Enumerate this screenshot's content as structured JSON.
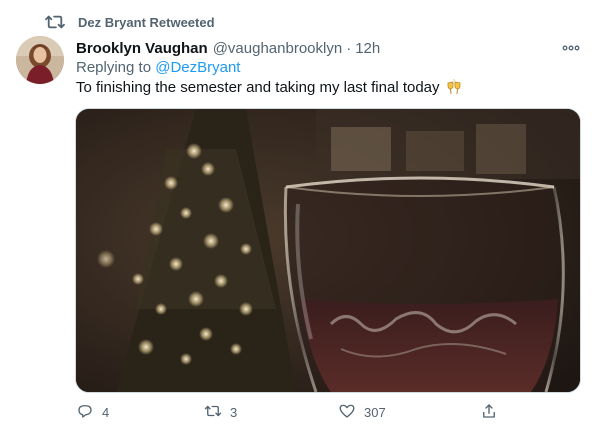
{
  "retweet": {
    "text": "Dez Bryant Retweeted"
  },
  "tweet": {
    "display_name": "Brooklyn Vaughan",
    "handle": "@vaughanbrooklyn",
    "separator": "·",
    "time": "12h",
    "reply_prefix": "Replying to",
    "reply_mention": "@DezBryant",
    "text": "To finishing the semester and taking my last final today"
  },
  "actions": {
    "reply_count": "4",
    "retweet_count": "3",
    "like_count": "307"
  },
  "icons": {
    "retweet": "retweet-icon",
    "more": "more-icon",
    "reply": "reply-icon",
    "like": "heart-icon",
    "share": "share-icon",
    "emoji": "clinking-glasses-emoji"
  },
  "colors": {
    "link": "#1d9bf0",
    "secondary_text": "#536471",
    "primary_text": "#0f1419"
  }
}
